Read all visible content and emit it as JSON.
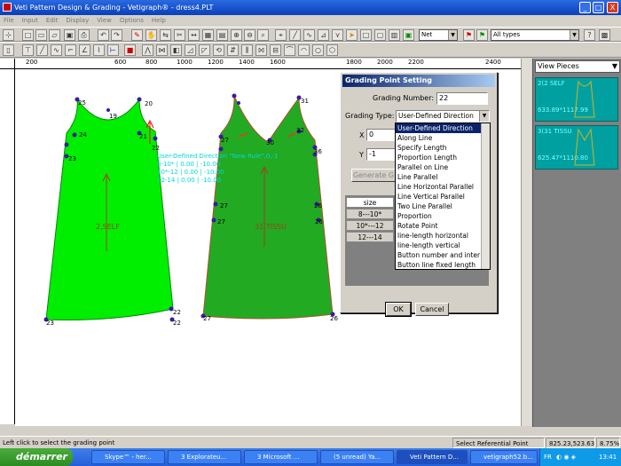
{
  "window": {
    "title": "Veti Pattern Design & Grading - Vetigraph® - dress4.PLT",
    "min": "_",
    "max": "□",
    "close": "X"
  },
  "menu": [
    "File",
    "Input",
    "Edit",
    "Display",
    "View",
    "Options",
    "Help"
  ],
  "toolbar": {
    "net_combo": "Net",
    "types_combo": "All types"
  },
  "ruler": {
    "labels": [
      "200",
      "600",
      "800",
      "1000",
      "1200",
      "1400",
      "1600",
      "1800",
      "2000",
      "2200",
      "2400"
    ]
  },
  "pieces_panel": {
    "combo": "View Pieces",
    "items": [
      {
        "name": "2(2 SELF",
        "dims": "633.89*1117.99"
      },
      {
        "name": "3(31 TISSU",
        "dims": "625.47*1110.80"
      }
    ]
  },
  "canvas": {
    "piece1_label": "2,SELF",
    "piece2_label": "31,TISSU",
    "grading_text": [
      "User-Defined Direction \"New Rule\",0,-1",
      "8-10*  |  0.00 | -10.00",
      "10*-12  |  0.00 | -10.00",
      "12-14  |  0.00 | -10.00"
    ],
    "points1": [
      "25",
      "20",
      "19",
      "24",
      "21",
      "22",
      "23",
      "22",
      "23",
      "22"
    ],
    "points2": [
      "31",
      "27",
      "30",
      "32",
      "36",
      "27",
      "26",
      "27",
      "26",
      "27",
      "26"
    ]
  },
  "dialog": {
    "title": "Grading Point Setting",
    "grading_number_label": "Grading Number:",
    "grading_number_value": "22",
    "grading_type_label": "Grading Type:",
    "grading_type_value": "User-Defined Direction",
    "x_label": "X",
    "x_value": "0",
    "y_label": "Y",
    "y_value": "-1",
    "generate_btn": "Generate G",
    "size_header": "size",
    "sizes": [
      "8---10*",
      "10*---12",
      "12---14"
    ],
    "ok": "OK",
    "cancel": "Cancel",
    "options": [
      "User-Defined Direction",
      "Along Line",
      "Specify Length",
      "Proportion Length",
      "Parallel on Line",
      "Line Parallel",
      "Line Horizontal Parallel",
      "Line Vertical Parallel",
      "Two Line Parallel",
      "Proportion",
      "Rotate Point",
      "line-length horizontal",
      "line-length vertical",
      "Button number and inter",
      "Button line fixed length"
    ]
  },
  "status": {
    "hint": "Left click to select the grading point",
    "mode": "Select Referential Point",
    "coords": "825.23,523.63",
    "zoom": "8.75%"
  },
  "taskbar": {
    "start": "démarrer",
    "tasks": [
      "Skype™ - her...",
      "3 Explorateu...",
      "3 Microsoft ...",
      "(5 unread) Ya...",
      "Veti Pattern D...",
      "vetigraph52.b..."
    ],
    "lang": "FR",
    "time": "13:41"
  },
  "colors": {
    "titlebar": "#0a3fb8",
    "piece1": "#00ee00",
    "piece2": "#22aa22",
    "dialog_title": "#0a246a",
    "pieces_bg": "#00a0a0"
  }
}
